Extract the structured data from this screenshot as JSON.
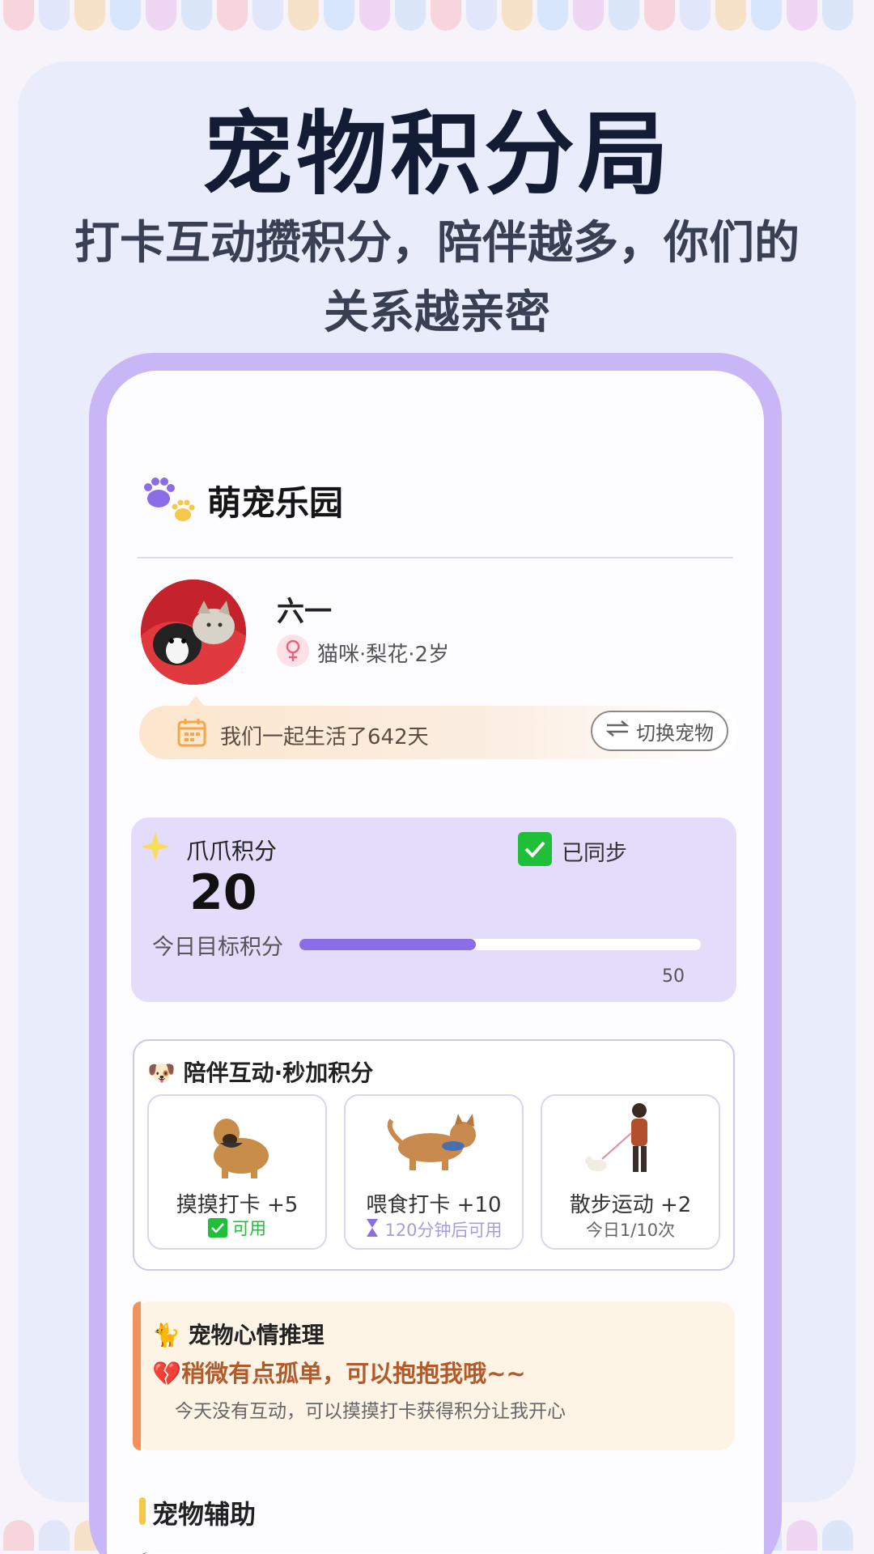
{
  "banner": {
    "headline": "宠物积分局",
    "subline": "打卡互动攒积分，陪伴越多，你们的关系越亲密"
  },
  "app": {
    "title": "萌宠乐园",
    "icon": "paw-icon"
  },
  "pet": {
    "name": "六一",
    "gender_icon": "female-icon",
    "info": "猫咪·梨花·2岁",
    "together_text": "我们一起生活了642天",
    "switch_label": "切换宠物"
  },
  "points": {
    "label": "爪爪积分",
    "value": "20",
    "synced_label": "已同步",
    "goal_label": "今日目标积分",
    "goal_max": "50",
    "progress_fraction": 0.44
  },
  "interaction": {
    "title": "陪伴互动·秒加积分",
    "tiles": [
      {
        "label": "摸摸打卡 +5",
        "status": "可用",
        "status_color": "#1fbf3a",
        "icon": "check-icon",
        "image": "dog-icon"
      },
      {
        "label": "喂食打卡 +10",
        "status": "120分钟后可用",
        "status_color": "#a89be0",
        "icon": "hourglass-icon",
        "image": "cat-eating-icon"
      },
      {
        "label": "散步运动 +2",
        "status": "今日1/10次",
        "status_color": "#666666",
        "icon": "",
        "image": "walking-person-icon"
      }
    ]
  },
  "mood": {
    "title": "宠物心情推理",
    "headline": "稍微有点孤单，可以抱抱我哦~~",
    "description": "今天没有互动，可以摸摸打卡获得积分让我开心"
  },
  "assist": {
    "title": "宠物辅助"
  },
  "colors": {
    "accent": "#8a6ee8",
    "frame": "#c8b6f6",
    "points_bg": "#e3dcfb",
    "success": "#1fbf3a"
  }
}
